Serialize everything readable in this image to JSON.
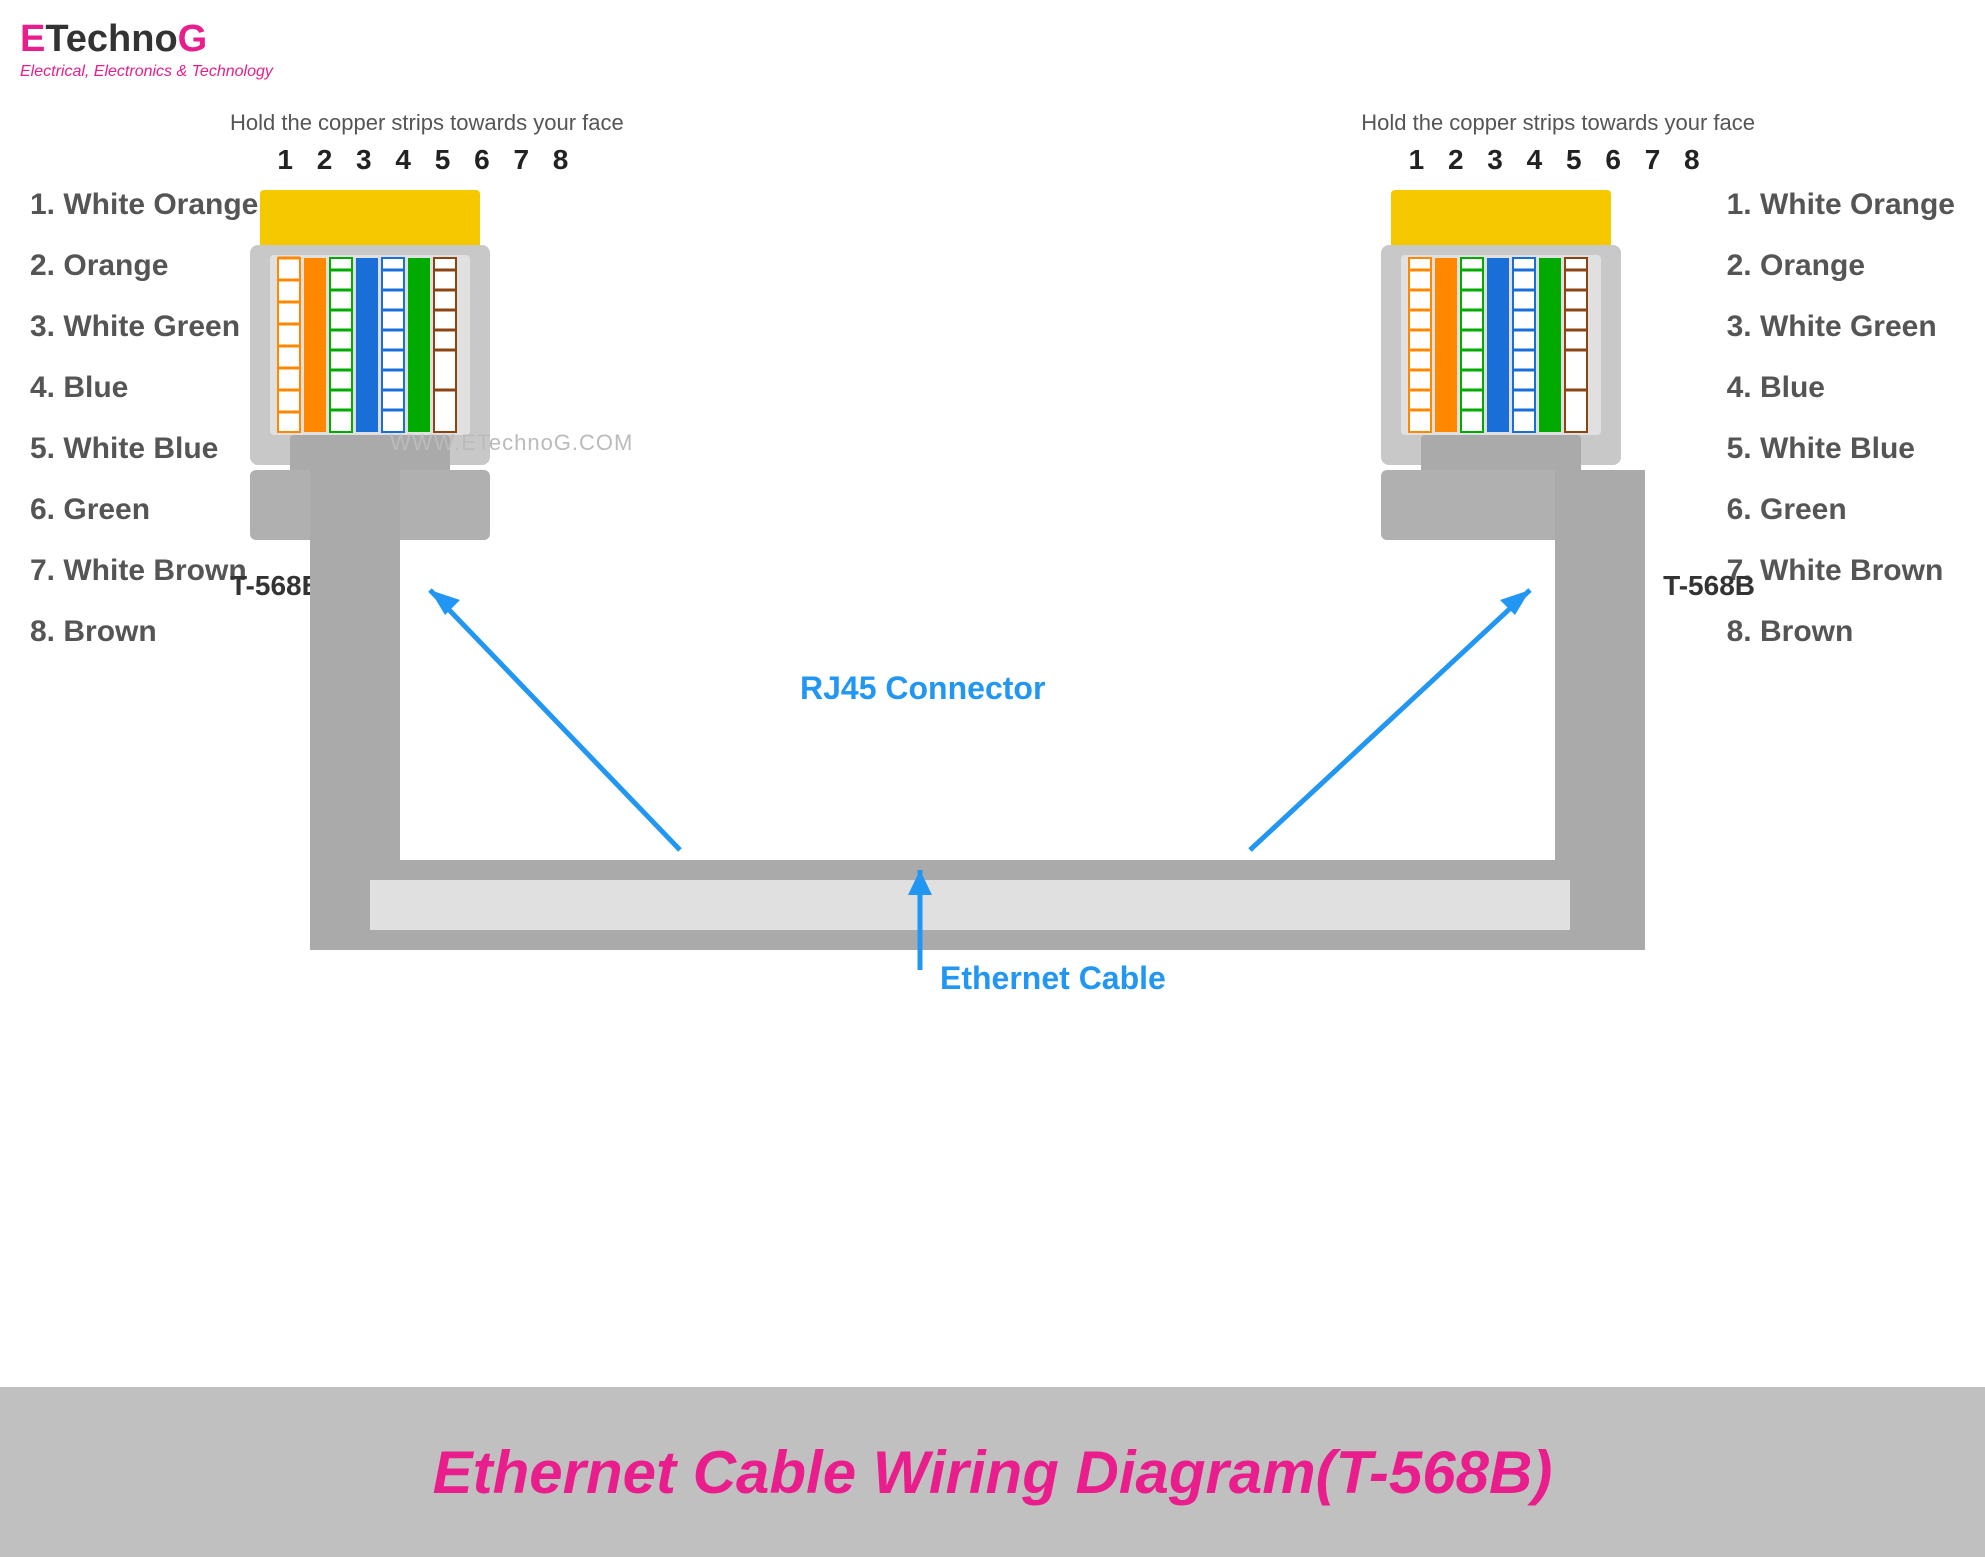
{
  "logo": {
    "e": "E",
    "techno": "Techno",
    "g": "G",
    "tagline": "Electrical, Electronics & Technology"
  },
  "left_instruction": "Hold the copper strips towards your face",
  "right_instruction": "Hold the copper strips towards your face",
  "pin_numbers": "1 2 3 4 5 6 7 8",
  "wire_labels": [
    "1. White Orange",
    "2. Orange",
    "3. White Green",
    "4. Blue",
    "5. White Blue",
    "6. Green",
    "7. White Brown",
    "8. Brown"
  ],
  "connector_label": "T-568B",
  "watermark": "WWW.ETechnoG.COM",
  "rj45_label": "RJ45 Connector",
  "ethernet_label": "Ethernet Cable",
  "bottom_title": "Ethernet Cable Wiring Diagram(T-568B)"
}
